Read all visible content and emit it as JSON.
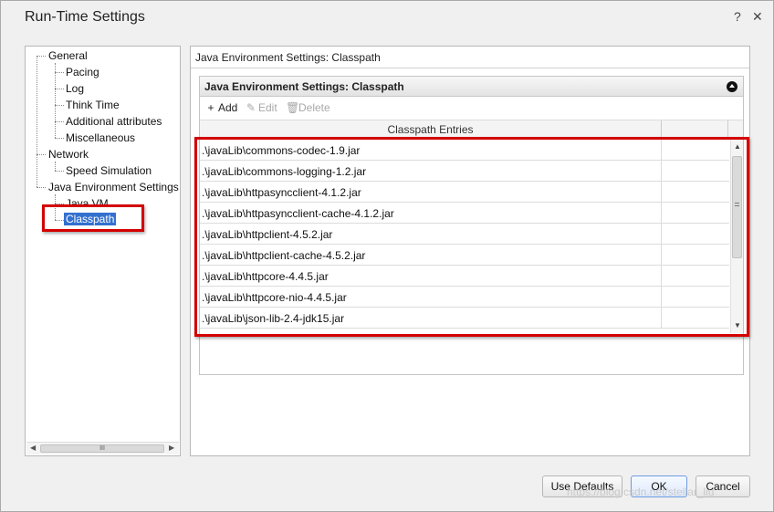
{
  "window": {
    "title": "Run-Time Settings",
    "help_glyph": "?",
    "close_glyph": "✕"
  },
  "tree": {
    "items": [
      {
        "label": "General",
        "level": 0
      },
      {
        "label": "Pacing",
        "level": 1
      },
      {
        "label": "Log",
        "level": 1
      },
      {
        "label": "Think Time",
        "level": 1
      },
      {
        "label": "Additional attributes",
        "level": 1
      },
      {
        "label": "Miscellaneous",
        "level": 1
      },
      {
        "label": "Network",
        "level": 0
      },
      {
        "label": "Speed Simulation",
        "level": 1
      },
      {
        "label": "Java Environment Settings",
        "level": 0
      },
      {
        "label": "Java VM",
        "level": 1
      },
      {
        "label": "Classpath",
        "level": 1,
        "selected": true
      }
    ],
    "scroll_grip": "III"
  },
  "content": {
    "heading": "Java Environment Settings: Classpath",
    "section_title": "Java Environment Settings: Classpath",
    "toolbar": {
      "add": "Add",
      "edit": "Edit",
      "delete": "Delete"
    },
    "grid": {
      "columns": [
        "Classpath Entries",
        ""
      ],
      "rows": [
        ".\\javaLib\\commons-codec-1.9.jar",
        ".\\javaLib\\commons-logging-1.2.jar",
        ".\\javaLib\\httpasyncclient-4.1.2.jar",
        ".\\javaLib\\httpasyncclient-cache-4.1.2.jar",
        ".\\javaLib\\httpclient-4.5.2.jar",
        ".\\javaLib\\httpclient-cache-4.5.2.jar",
        ".\\javaLib\\httpcore-4.4.5.jar",
        ".\\javaLib\\httpcore-nio-4.4.5.jar",
        ".\\javaLib\\json-lib-2.4-jdk15.jar"
      ]
    }
  },
  "buttons": {
    "use_defaults": "Use Defaults",
    "ok": "OK",
    "cancel": "Cancel"
  },
  "watermark": "https://blog.csdn.net/stellar_liu",
  "colors": {
    "highlight_red": "#d40000",
    "selection_blue": "#3370d0"
  }
}
